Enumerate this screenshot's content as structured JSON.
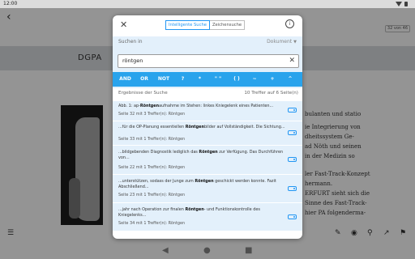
{
  "status_bar": {
    "time": "12:00"
  },
  "background": {
    "page_indicator": "32 von 46",
    "heading": "DGPA",
    "right_text_lines": [
      "bulanten und statio",
      "ie Integrierung von",
      "dheitssystem Ge-",
      "ad Nöth und seinen",
      "in der Medizin so",
      "",
      "ler Fast-Track-Konzept",
      "hermann.",
      "ERFURT sieht sich die",
      "Sinne des Fast-Track-",
      "hier PA folgenderma-"
    ]
  },
  "dialog": {
    "modes": [
      "Intelligente Suche",
      "Zeichensuche"
    ],
    "active_mode": "Intelligente Suche",
    "scope_label": "Suchen in",
    "scope_value": "Dokument",
    "query": "röntgen",
    "operators": [
      "AND",
      "OR",
      "NOT",
      "?",
      "*",
      "\" \"",
      "( )",
      "~",
      "+",
      "^"
    ],
    "results_label": "Ergebnisse der Suche",
    "results_count": "10 Treffer auf 6 Seite(n)",
    "results": [
      {
        "before": "Abb. 1: ap-",
        "match": "Röntgen",
        "after": "aufnahme im Stehen: linkes Kniegelenk eines Patienten...",
        "before2": "",
        "match2": "",
        "after2": "",
        "meta": "Seite 32 mit 3 Treffer(n): Röntgen"
      },
      {
        "before": "...für die OP-Planung essentiellen ",
        "match": "Röntgen",
        "after": "bilder auf Vollständigkeit. Die Sichtung...",
        "before2": "",
        "match2": "",
        "after2": "",
        "meta": "Seite 33 mit 1 Treffer(n): Röntgen"
      },
      {
        "before": "...bildgebenden Diagnostik lediglich das ",
        "match": "Röntgen",
        "after": " zur Verfügung. Das Durchführen von...",
        "before2": "",
        "match2": "",
        "after2": "",
        "meta": "Seite 22 mit 1 Treffer(n): Röntgen"
      },
      {
        "before": "...unterstützen, sodass der Junge zum ",
        "match": "Röntgen",
        "after": " geschickt werden konnte. Fazit Abschließend...",
        "before2": "",
        "match2": "",
        "after2": "",
        "meta": "Seite 23 mit 1 Treffer(n): Röntgen"
      },
      {
        "before": "...jahr nach Operation zur finalen ",
        "match": "Röntgen",
        "after": "- und Funktionskontrolle des Kniegelenks...",
        "before2": "",
        "match2": "",
        "after2": "",
        "meta": "Seite 34 mit 1 Treffer(n): Röntgen"
      }
    ]
  }
}
